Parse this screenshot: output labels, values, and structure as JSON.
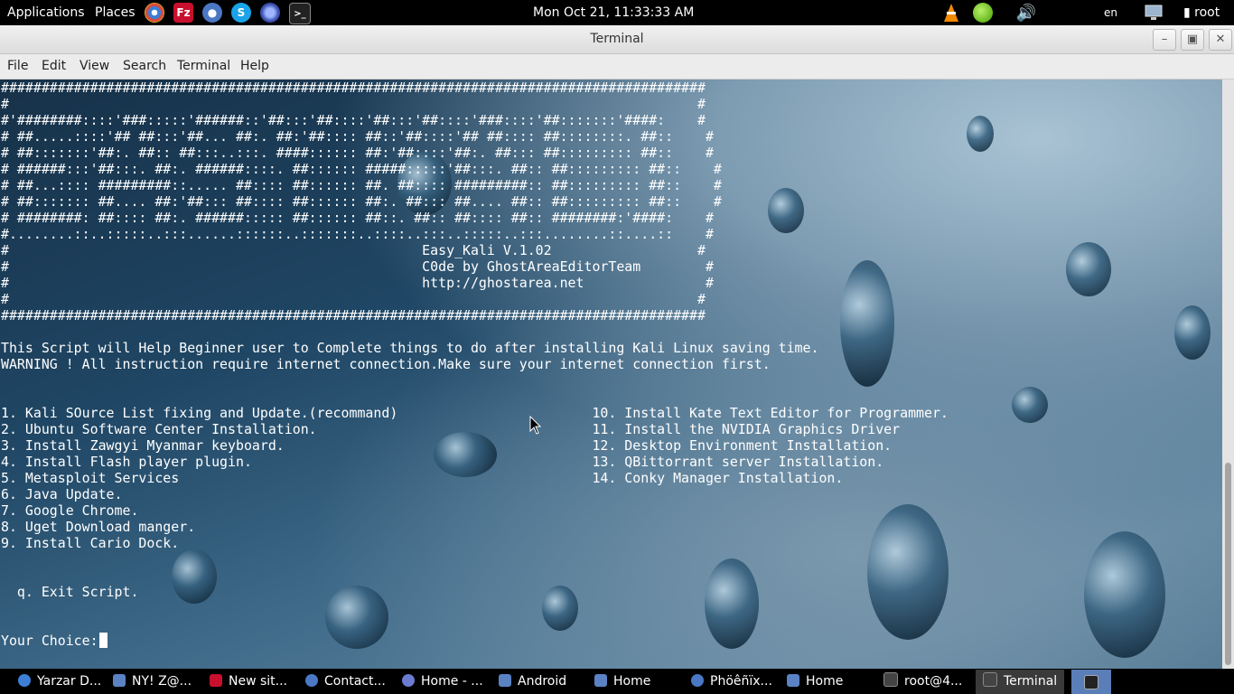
{
  "top_panel": {
    "applications": "Applications",
    "places": "Places",
    "launchers": [
      "chrome-icon",
      "filezilla-icon",
      "pidgin-icon",
      "skype-icon",
      "firefox-icon",
      "terminal-icon"
    ],
    "clock": "Mon Oct 21, 11:33:33 AM",
    "keyboard_layout": "en",
    "user": "root"
  },
  "window": {
    "title": "Terminal",
    "controls": [
      "minimize",
      "maximize",
      "close"
    ]
  },
  "menubar": [
    "File",
    "Edit",
    "View",
    "Search",
    "Terminal",
    "Help"
  ],
  "terminal": {
    "lines": [
      "#######################################################################################",
      "#                                                                                     #",
      "#'########::::'###:::::'######::'##:::'##::::'##:::'##::::'###::::'##:::::::'####:    #",
      "# ##.....::::'## ##:::'##... ##:. ##:'##:::: ##::'##::::'## ##:::: ##::::::::. ##::    #",
      "# ##:::::::'##:. ##:: ##:::..:::. ####:::::: ##:'##::::'##:. ##::: ##::::::::: ##::    #",
      "# ######:::'##:::. ##:. ######::::. ##:::::: #####:::::'##:::. ##:: ##::::::::: ##::    #",
      "# ##...:::: #########::..... ##:::: ##:::::: ##. ##:::: #########:: ##::::::::: ##::    #",
      "# ##::::::: ##.... ##:'##::: ##:::: ##:::::: ##:. ##::: ##.... ##:: ##::::::::: ##::    #",
      "# ########: ##:::: ##:. ######::::: ##:::::: ##::. ##:: ##:::: ##:: ########:'####:    #",
      "#........::..:::::..:::......::::::..:::::::..::::..:::..:::::..:::........::....::    #",
      "#                                                   Easy_Kali V.1.02                  #",
      "#                                                   C0de by GhostAreaEditorTeam        #",
      "#                                                   http://ghostarea.net               #",
      "#                                                                                     #",
      "#######################################################################################",
      "",
      "This Script will Help Beginner user to Complete things to do after installing Kali Linux saving time.",
      "WARNING ! All instruction require internet connection.Make sure your internet connection first.",
      "",
      "",
      "1. Kali SOurce List fixing and Update.(recommand)                        10. Install Kate Text Editor for Programmer.",
      "2. Ubuntu Software Center Installation.                                  11. Install the NVIDIA Graphics Driver",
      "3. Install Zawgyi Myanmar keyboard.                                      12. Desktop Environment Installation.",
      "4. Install Flash player plugin.                                          13. QBittorrant server Installation.",
      "5. Metasploit Services                                                   14. Conky Manager Installation.",
      "6. Java Update.",
      "7. Google Chrome.",
      "8. Uget Download manger.",
      "9. Install Cario Dock.",
      "",
      "",
      "  q. Exit Script.",
      "",
      ""
    ],
    "prompt": "Your Choice:"
  },
  "taskbar": [
    {
      "label": "Yarzar D...",
      "icon": "chrome-icon",
      "color": "#3d7fd6"
    },
    {
      "label": "NY! Z@...",
      "icon": "folder-icon",
      "color": "#5b83c4"
    },
    {
      "label": "New sit...",
      "icon": "filezilla-icon",
      "color": "#c8102e"
    },
    {
      "label": "Contact...",
      "icon": "pidgin-icon",
      "color": "#4b78c4"
    },
    {
      "label": "Home - ...",
      "icon": "firefox-icon",
      "color": "#6a7bd0"
    },
    {
      "label": "Android",
      "icon": "folder-icon",
      "color": "#5b83c4"
    },
    {
      "label": "Home",
      "icon": "home-folder-icon",
      "color": "#5b83c4"
    },
    {
      "label": "Phöêñïx...",
      "icon": "pidgin-icon",
      "color": "#4b78c4"
    },
    {
      "label": "Home",
      "icon": "home-folder-icon",
      "color": "#5b83c4"
    },
    {
      "label": "root@4...",
      "icon": "terminal-icon",
      "color": "#444444"
    },
    {
      "label": "Terminal",
      "icon": "terminal-icon",
      "color": "#444444",
      "active": true
    }
  ],
  "colors": {
    "panel_bg": "#000000",
    "terminal_fg": "#ffffff",
    "titlebar_bg": "#e6e6e6"
  }
}
